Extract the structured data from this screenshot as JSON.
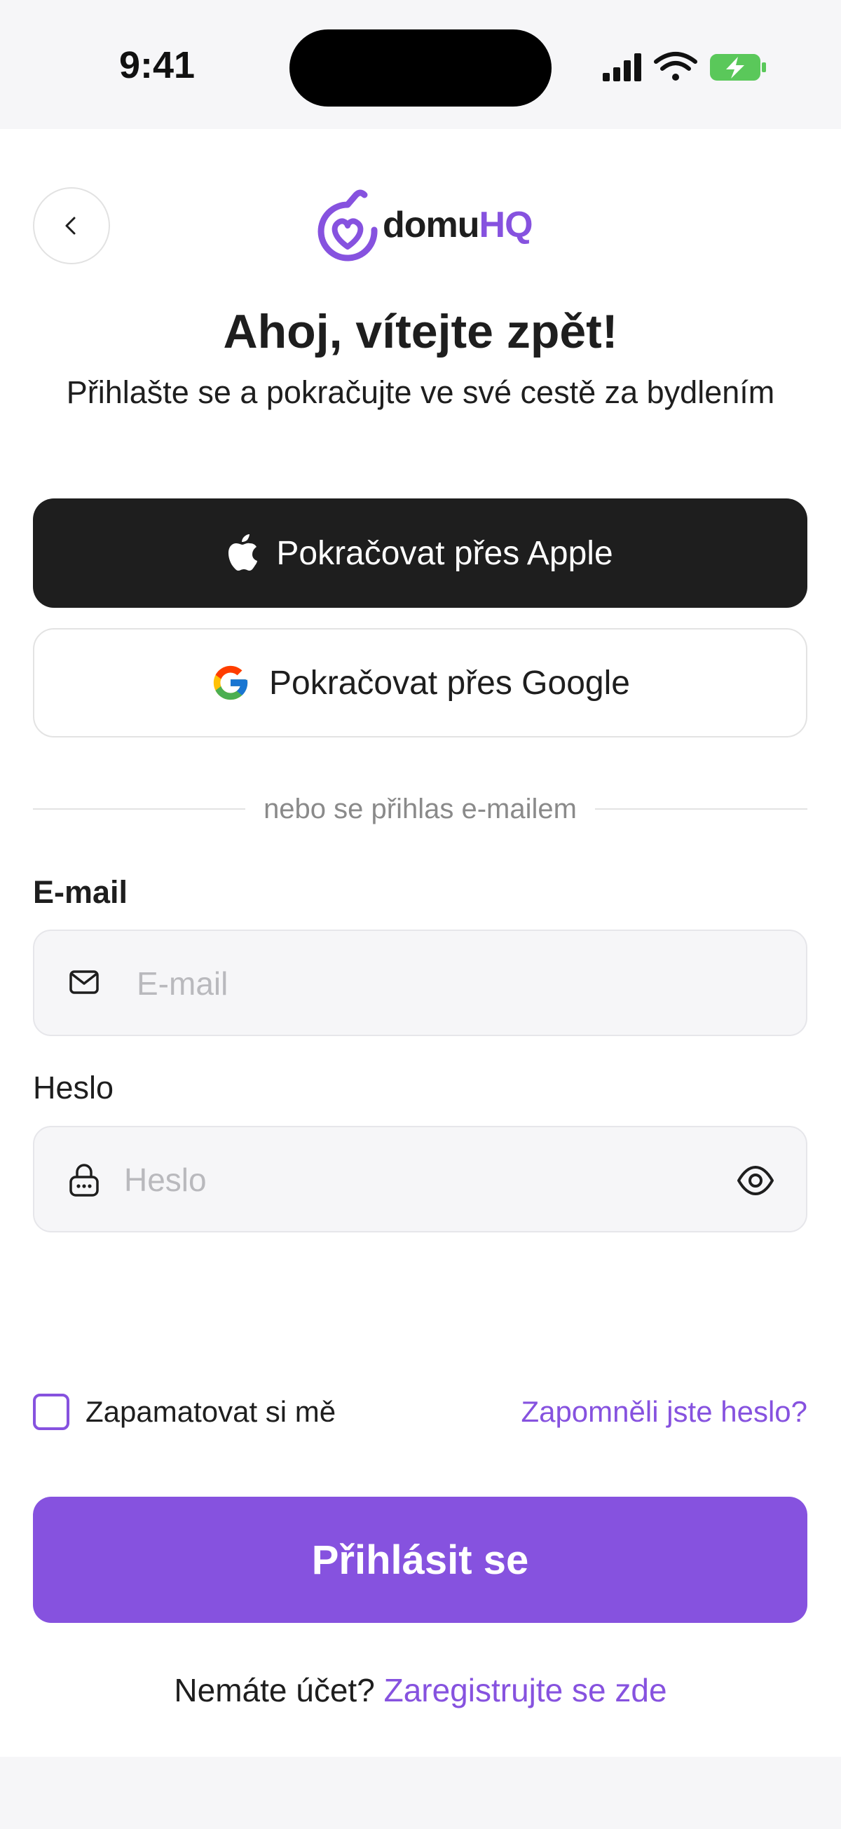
{
  "status_bar": {
    "time": "9:41",
    "icons": [
      "signal-icon",
      "wifi-icon",
      "battery-charging-icon"
    ]
  },
  "header": {
    "back_icon": "chevron-left-icon",
    "logo_icon": "heart-house-icon",
    "logo_text_part1": "domu",
    "logo_text_part2": "HQ"
  },
  "title": "Ahoj, vítejte zpět!",
  "subtitle": "Přihlašte se a pokračujte ve své cestě za bydlením",
  "social": {
    "apple_label": "Pokračovat přes Apple",
    "apple_icon": "apple-icon",
    "google_label": "Pokračovat přes Google",
    "google_icon": "google-icon"
  },
  "divider_text": "nebo se přihlas e-mailem",
  "form": {
    "email_label": "E-mail",
    "email_placeholder": "E-mail",
    "email_value": "",
    "email_icon": "mail-icon",
    "password_label": "Heslo",
    "password_placeholder": "Heslo",
    "password_value": "",
    "password_icon": "lock-icon",
    "show_password_icon": "eye-icon",
    "remember_label": "Zapamatovat si mě",
    "remember_checked": false,
    "forgot_label": "Zapomněli jste heslo?",
    "submit_label": "Přihlásit se"
  },
  "signup": {
    "question": "Nemáte účet?",
    "link": "Zaregistrujte se zde"
  },
  "colors": {
    "accent": "#8652df",
    "dark": "#1e1e1e",
    "background": "#ffffff",
    "muted_background": "#f6f6f8"
  }
}
